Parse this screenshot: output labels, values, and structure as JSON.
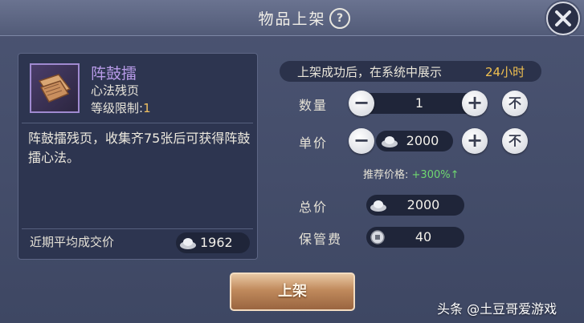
{
  "header": {
    "title": "物品上架",
    "help_icon": "question-icon",
    "close_icon": "close-icon"
  },
  "item": {
    "name": "阵鼓擂",
    "type": "心法残页",
    "level_label": "等级限制:",
    "level_value": "1",
    "description": "阵鼓擂残页，收集齐75张后可获得阵鼓擂心法。",
    "avg_price_label": "近期平均成交价",
    "avg_price_value": "1962",
    "icon": "scroll-page-icon"
  },
  "listing": {
    "notice": "上架成功后，在系统中展示",
    "notice_hours": "24小时",
    "quantity_label": "数量",
    "quantity_value": "1",
    "unit_price_label": "单价",
    "unit_price_value": "2000",
    "max_label": "不",
    "recommend_label": "推荐价格:",
    "recommend_value": "+300%",
    "total_label": "总价",
    "total_value": "2000",
    "fee_label": "保管费",
    "fee_value": "40",
    "confirm_label": "上架"
  },
  "watermark": "头条 @土豆哥爱游戏",
  "colors": {
    "item_name": "#b89be8",
    "highlight": "#f0c050",
    "recommend": "#6fd870",
    "confirm_button": "#c08a5c"
  }
}
